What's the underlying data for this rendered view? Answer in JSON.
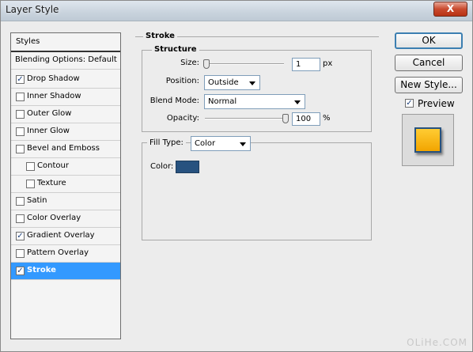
{
  "window": {
    "title": "Layer Style",
    "close_glyph": "X"
  },
  "styles_panel": {
    "header": "Styles",
    "items": [
      {
        "label": "Blending Options: Default",
        "has_checkbox": false,
        "checked": false,
        "indent": false,
        "selected": false
      },
      {
        "label": "Drop Shadow",
        "has_checkbox": true,
        "checked": true,
        "indent": false,
        "selected": false
      },
      {
        "label": "Inner Shadow",
        "has_checkbox": true,
        "checked": false,
        "indent": false,
        "selected": false
      },
      {
        "label": "Outer Glow",
        "has_checkbox": true,
        "checked": false,
        "indent": false,
        "selected": false
      },
      {
        "label": "Inner Glow",
        "has_checkbox": true,
        "checked": false,
        "indent": false,
        "selected": false
      },
      {
        "label": "Bevel and Emboss",
        "has_checkbox": true,
        "checked": false,
        "indent": false,
        "selected": false
      },
      {
        "label": "Contour",
        "has_checkbox": true,
        "checked": false,
        "indent": true,
        "selected": false
      },
      {
        "label": "Texture",
        "has_checkbox": true,
        "checked": false,
        "indent": true,
        "selected": false
      },
      {
        "label": "Satin",
        "has_checkbox": true,
        "checked": false,
        "indent": false,
        "selected": false
      },
      {
        "label": "Color Overlay",
        "has_checkbox": true,
        "checked": false,
        "indent": false,
        "selected": false
      },
      {
        "label": "Gradient Overlay",
        "has_checkbox": true,
        "checked": true,
        "indent": false,
        "selected": false
      },
      {
        "label": "Pattern Overlay",
        "has_checkbox": true,
        "checked": false,
        "indent": false,
        "selected": false
      },
      {
        "label": "Stroke",
        "has_checkbox": true,
        "checked": true,
        "indent": false,
        "selected": true
      }
    ]
  },
  "stroke": {
    "section_title": "Stroke",
    "structure_title": "Structure",
    "size": {
      "label": "Size:",
      "value": "1",
      "unit": "px",
      "slider_fraction": 0.0
    },
    "position": {
      "label": "Position:",
      "value": "Outside"
    },
    "blend_mode": {
      "label": "Blend Mode:",
      "value": "Normal"
    },
    "opacity": {
      "label": "Opacity:",
      "value": "100",
      "unit": "%",
      "slider_fraction": 1.0
    },
    "fill_type": {
      "label": "Fill Type:",
      "value": "Color"
    },
    "color": {
      "label": "Color:",
      "swatch": "#27527f"
    }
  },
  "actions": {
    "ok": "OK",
    "cancel": "Cancel",
    "new_style": "New Style...",
    "preview_label": "Preview",
    "preview_checked": true,
    "check_glyph": "✓"
  },
  "colors": {
    "selection": "#3399ff",
    "preview_fill": "#f9b81a",
    "stroke_color": "#27527f"
  },
  "watermark": "OLiHe.COM"
}
